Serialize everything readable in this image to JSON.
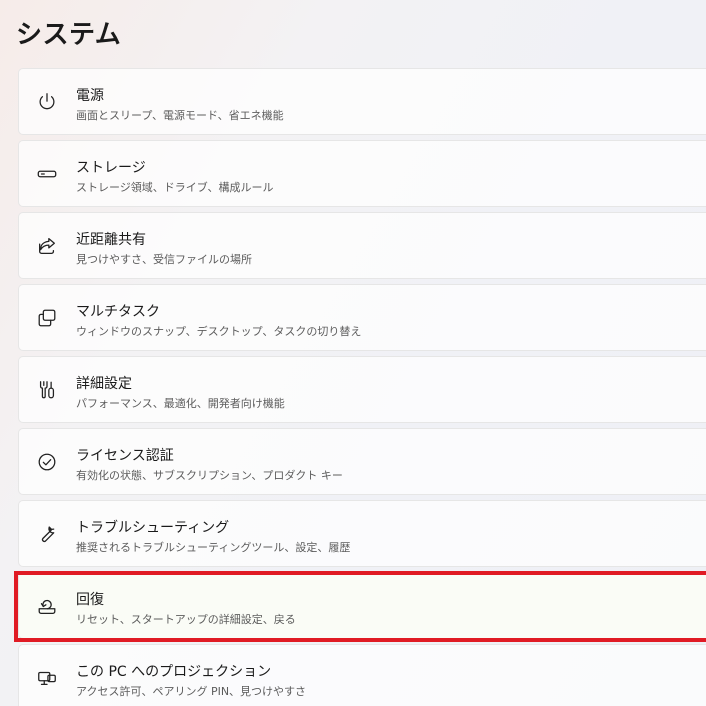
{
  "header": {
    "title": "システム"
  },
  "items": [
    {
      "title": "電源",
      "subtitle": "画面とスリープ、電源モード、省エネ機能",
      "icon": "power-icon"
    },
    {
      "title": "ストレージ",
      "subtitle": "ストレージ領域、ドライブ、構成ルール",
      "icon": "storage-drive-icon"
    },
    {
      "title": "近距離共有",
      "subtitle": "見つけやすさ、受信ファイルの場所",
      "icon": "share-icon"
    },
    {
      "title": "マルチタスク",
      "subtitle": "ウィンドウのスナップ、デスクトップ、タスクの切り替え",
      "icon": "multitasking-windows-icon"
    },
    {
      "title": "詳細設定",
      "subtitle": "パフォーマンス、最適化、開発者向け機能",
      "icon": "advanced-tools-icon"
    },
    {
      "title": "ライセンス認証",
      "subtitle": "有効化の状態、サブスクリプション、プロダクト キー",
      "icon": "checkmark-circle-icon"
    },
    {
      "title": "トラブルシューティング",
      "subtitle": "推奨されるトラブルシューティングツール、設定、履歴",
      "icon": "wrench-icon"
    },
    {
      "title": "回復",
      "subtitle": "リセット、スタートアップの詳細設定、戻る",
      "icon": "recovery-icon"
    },
    {
      "title": "この PC へのプロジェクション",
      "subtitle": "アクセス許可、ペアリング PIN、見つけやすさ",
      "icon": "projection-icon"
    }
  ],
  "highlight": {
    "color": "#e01b24",
    "target": "回復"
  }
}
